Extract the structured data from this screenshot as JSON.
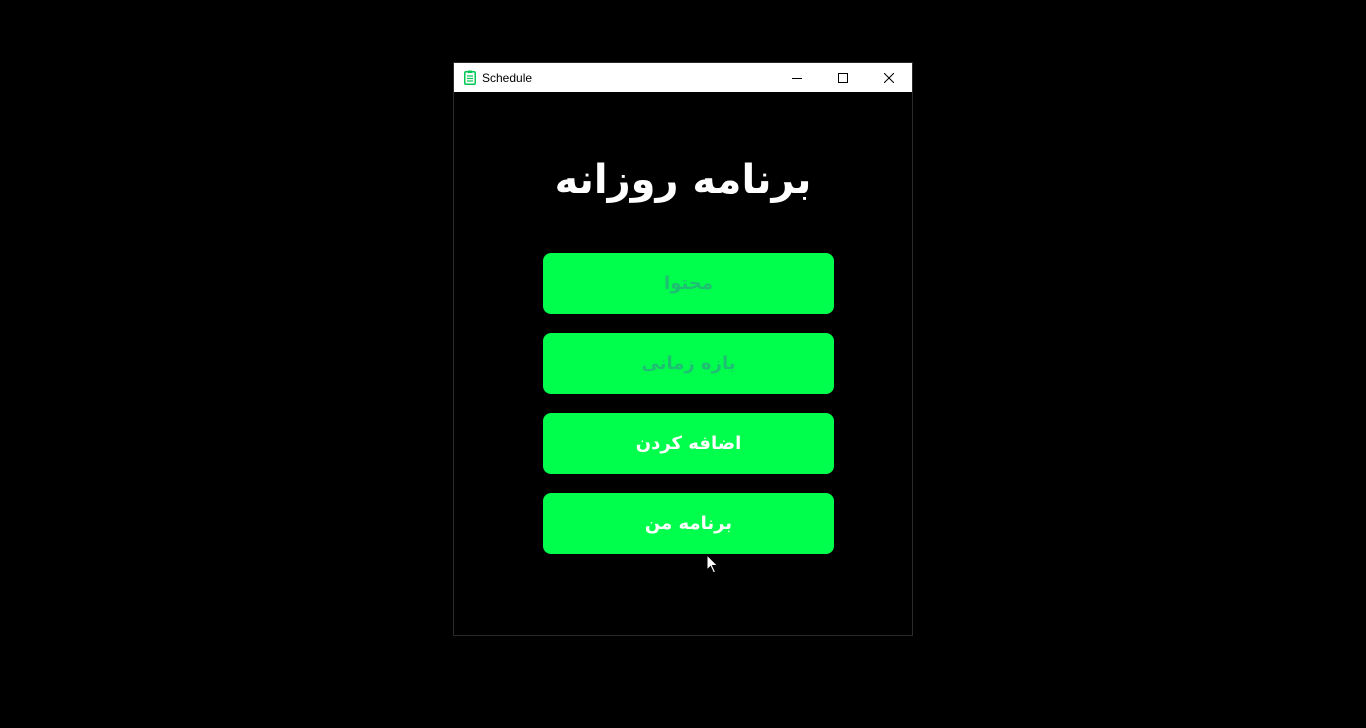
{
  "window": {
    "title": "Schedule",
    "icon": "clipboard-icon",
    "controls": [
      "minimize-icon",
      "maximize-icon",
      "close-icon"
    ]
  },
  "main": {
    "heading": "برنامه روزانه",
    "inputs": [
      {
        "placeholder": "محتوا"
      },
      {
        "placeholder": "بازه زمانی"
      }
    ],
    "buttons": [
      {
        "label": "اضافه کردن"
      },
      {
        "label": "برنامه من"
      }
    ]
  },
  "colors": {
    "background": "#000000",
    "accent": "#00ff4c",
    "placeholder_text": "#1fbf73",
    "button_text": "#ffffff",
    "titlebar": "#ffffff"
  }
}
